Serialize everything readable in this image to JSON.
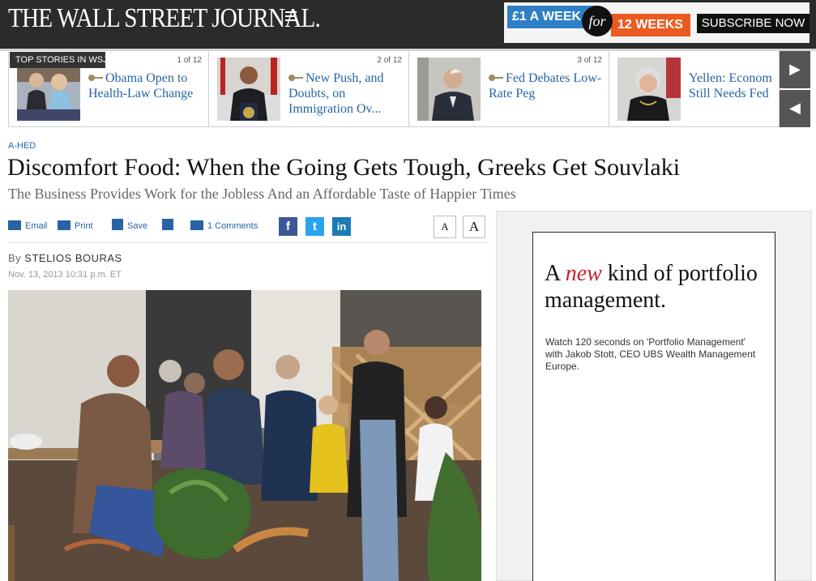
{
  "masthead": {
    "logo": "THE WALL STREET JOURNAL.",
    "promo_price": "£1 A WEEK",
    "promo_for": "for",
    "promo_weeks": "12 WEEKS",
    "subscribe_label": "SUBSCRIBE NOW"
  },
  "top_stories": {
    "label": "TOP STORIES IN WSJ",
    "items": [
      {
        "count": "1 of 12",
        "headline": "Obama Open to Health-Law Change"
      },
      {
        "count": "2 of 12",
        "headline": "New Push, and Doubts, on Immigration Ov..."
      },
      {
        "count": "3 of 12",
        "headline": "Fed Debates Low-Rate Peg"
      },
      {
        "count": "",
        "headline": "Yellen: Econom Still Needs Fed"
      }
    ],
    "next_icon": "▶",
    "prev_icon": "◀"
  },
  "article": {
    "kicker": "A-HED",
    "title": "Discomfort Food: When the Going Gets Tough, Greeks Get Souvlaki",
    "dek": "The Business Provides Work for the Jobless And an Affordable Taste of Happier Times",
    "by_prefix": "By",
    "author": "STELIOS BOURAS",
    "date": "Nov. 13, 2013 10:31 p.m. ET"
  },
  "tools": {
    "email": "Email",
    "print": "Print",
    "save": "Save",
    "comments": "1 Comments",
    "facebook": "f",
    "twitter": "t",
    "linkedin": "in",
    "font_small": "A",
    "font_large": "A"
  },
  "ad": {
    "head_a": "A ",
    "head_new": "new",
    "head_b": " kind of portfolio management.",
    "body": "Watch 120 seconds on 'Portfolio Management' with Jakob Stott, CEO UBS Wealth Management Europe."
  },
  "colors": {
    "masthead_bg": "#2b2b2b",
    "link_blue": "#2763a5",
    "promo_blue": "#2f7fc4",
    "promo_orange": "#ea5b22",
    "ad_red": "#c0272d"
  }
}
